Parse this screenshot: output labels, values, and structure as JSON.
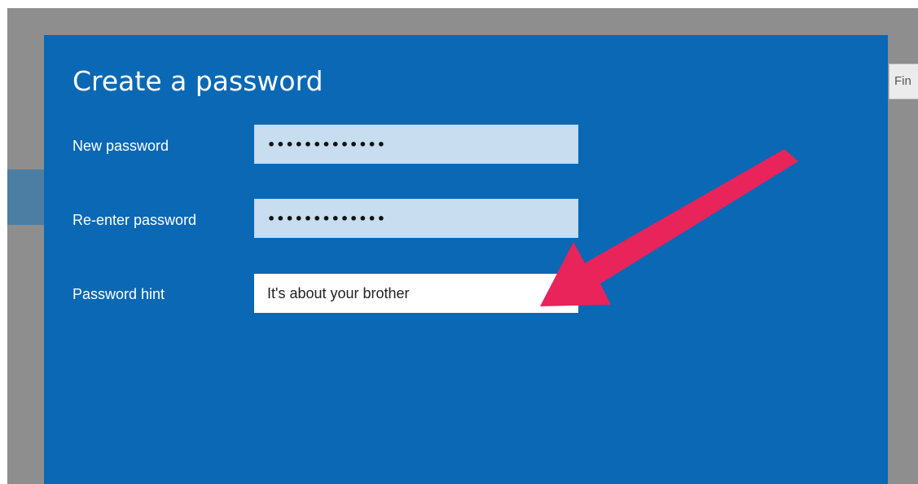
{
  "background": {
    "find_button_label": "Fin"
  },
  "dialog": {
    "title": "Create a password",
    "fields": {
      "new_password": {
        "label": "New password",
        "value": "•••••••••••••"
      },
      "reenter_password": {
        "label": "Re-enter password",
        "value": "•••••••••••••"
      },
      "password_hint": {
        "label": "Password hint",
        "value": "It's about your brother"
      }
    }
  },
  "annotation": {
    "icon": "arrow-pointer-icon",
    "color": "#e8245a"
  },
  "colors": {
    "dialog_background": "#0a68b5",
    "input_background": "#c8ddef",
    "hint_background": "#ffffff",
    "page_background": "#8e8e8e"
  }
}
